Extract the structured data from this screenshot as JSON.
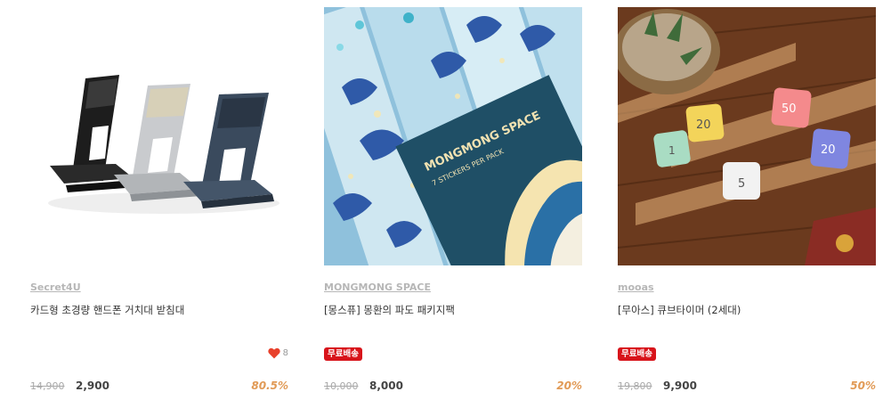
{
  "products": [
    {
      "brand": "Secret4U",
      "title": "카드형 초경량 핸드폰 거치대 받침대",
      "likes": "8",
      "badge": "",
      "original_price": "14,900",
      "sale_price": "2,900",
      "discount": "80.5%"
    },
    {
      "brand": "MONGMONG SPACE",
      "title": "[몽스퓨] 몽환의 파도 패키지팩",
      "likes": "",
      "badge": "무료배송",
      "original_price": "10,000",
      "sale_price": "8,000",
      "discount": "20%",
      "pack_brand_text": "MONGMONG SPACE",
      "pack_sub_text": "7 STICKERS PER PACK"
    },
    {
      "brand": "mooas",
      "title": "[무아스] 큐브타이머 (2세대)",
      "likes": "",
      "badge": "무료배송",
      "original_price": "19,800",
      "sale_price": "9,900",
      "discount": "50%",
      "cube_numbers": [
        "1",
        "20",
        "5",
        "50",
        "20"
      ]
    }
  ],
  "colors": {
    "brand_link": "#b7b7b7",
    "badge_bg": "#d8141b",
    "discount": "#e19a56",
    "heart": "#e8412c"
  },
  "icons": {
    "like": "heart-icon"
  }
}
